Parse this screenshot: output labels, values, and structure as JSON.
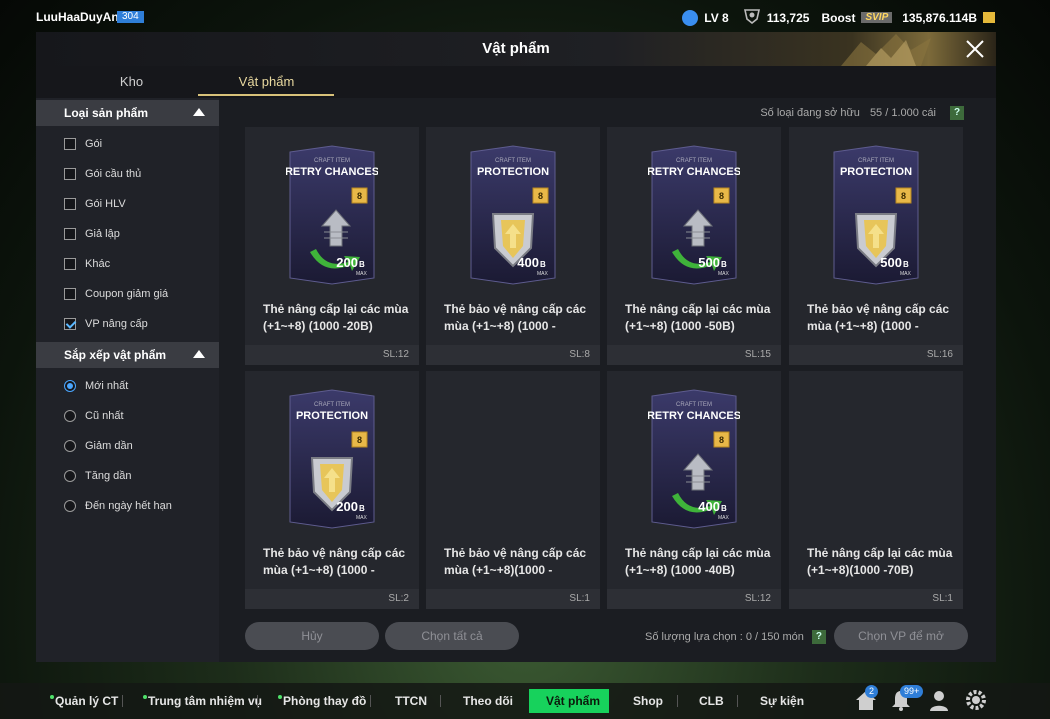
{
  "user": {
    "name": "LuuHaaDuyAnh",
    "level_badge": "304"
  },
  "stats": {
    "lv": "LV 8",
    "coins": "113,725",
    "boost": "Boost",
    "svip": "SVIP",
    "bp": "135,876.114B"
  },
  "panel": {
    "title": "Vật phẩm",
    "tabs": [
      {
        "label": "Kho"
      },
      {
        "label": "Vật phẩm"
      }
    ]
  },
  "sidebar": {
    "filter_heading": "Loại sản phẩm",
    "filters": [
      {
        "label": "Gói",
        "checked": false
      },
      {
        "label": "Gói cầu thủ",
        "checked": false
      },
      {
        "label": "Gói HLV",
        "checked": false
      },
      {
        "label": "Giả lập",
        "checked": false
      },
      {
        "label": "Khác",
        "checked": false
      },
      {
        "label": "Coupon giảm giá",
        "checked": false
      },
      {
        "label": "VP nâng cấp",
        "checked": true
      }
    ],
    "sort_heading": "Sắp xếp vật phẩm",
    "sorts": [
      {
        "label": "Mới nhất",
        "selected": true
      },
      {
        "label": "Cũ nhất",
        "selected": false
      },
      {
        "label": "Giảm dần",
        "selected": false
      },
      {
        "label": "Tăng dần",
        "selected": false
      },
      {
        "label": "Đến ngày hết hạn",
        "selected": false
      }
    ]
  },
  "owned": {
    "label": "Số loại đang sở hữu",
    "value": "55 / 1.000 cái",
    "help": "?"
  },
  "items": [
    {
      "kind": "retry",
      "card_top": "CRAFT ITEM",
      "card_title": "RETRY CHANCES",
      "level": "8",
      "amount": "200",
      "unit": "B",
      "max": "MAX",
      "name": "Thẻ nâng cấp lại các mùa (+1~+8) (1000 -20B)",
      "qty": "SL:12"
    },
    {
      "kind": "protect",
      "card_top": "CRAFT ITEM",
      "card_title": "PROTECTION",
      "level": "8",
      "amount": "400",
      "unit": "B",
      "max": "MAX",
      "name": "Thẻ bảo vệ nâng cấp các mùa (+1~+8) (1000 -",
      "qty": "SL:8"
    },
    {
      "kind": "retry",
      "card_top": "CRAFT ITEM",
      "card_title": "RETRY CHANCES",
      "level": "8",
      "amount": "500",
      "unit": "B",
      "max": "MAX",
      "name": "Thẻ nâng cấp lại các mùa (+1~+8) (1000 -50B)",
      "qty": "SL:15"
    },
    {
      "kind": "protect",
      "card_top": "CRAFT ITEM",
      "card_title": "PROTECTION",
      "level": "8",
      "amount": "500",
      "unit": "B",
      "max": "MAX",
      "name": "Thẻ bảo vệ nâng cấp các mùa (+1~+8) (1000 -",
      "qty": "SL:16"
    },
    {
      "kind": "protect",
      "card_top": "CRAFT ITEM",
      "card_title": "PROTECTION",
      "level": "8",
      "amount": "200",
      "unit": "B",
      "max": "MAX",
      "name": "Thẻ bảo vệ nâng cấp các mùa (+1~+8) (1000 -",
      "qty": "SL:2"
    },
    {
      "kind": "none",
      "name": "Thẻ bảo vệ nâng cấp các mùa (+1~+8)(1000 -",
      "qty": "SL:1"
    },
    {
      "kind": "retry",
      "card_top": "CRAFT ITEM",
      "card_title": "RETRY CHANCES",
      "level": "8",
      "amount": "400",
      "unit": "B",
      "max": "MAX",
      "name": "Thẻ nâng cấp lại các mùa (+1~+8) (1000 -40B)",
      "qty": "SL:12"
    },
    {
      "kind": "none",
      "name": "Thẻ nâng cấp lại các mùa (+1~+8)(1000 -70B)",
      "qty": "SL:1"
    }
  ],
  "actions": {
    "cancel": "Hủy",
    "select_all": "Chọn tất cả",
    "count_label": "Số lượng lựa chọn : 0 / 150 món",
    "help": "?",
    "open": "Chọn VP để mở"
  },
  "nav": {
    "items": [
      {
        "label": "Quản lý CT",
        "dot": true
      },
      {
        "label": "Trung tâm nhiệm vụ",
        "dot": true
      },
      {
        "label": "Phòng thay đồ",
        "dot": true
      },
      {
        "label": "TTCN",
        "dot": false
      },
      {
        "label": "Theo dõi",
        "dot": false
      },
      {
        "label": "Vật phẩm",
        "dot": false,
        "active": true
      },
      {
        "label": "Shop",
        "dot": false
      },
      {
        "label": "CLB",
        "dot": false
      },
      {
        "label": "Sự kiện",
        "dot": false
      }
    ],
    "home_badge": "2",
    "bell_badge": "99+"
  },
  "colors": {
    "accent_green": "#17d25c",
    "gold": "#d8c27a",
    "blue": "#2f7ed8"
  },
  "icons": [
    "lv-face-icon",
    "coin-shield-icon",
    "bp-icon",
    "close-icon",
    "help-icon",
    "home-icon",
    "bell-icon",
    "profile-icon",
    "settings-icon"
  ]
}
